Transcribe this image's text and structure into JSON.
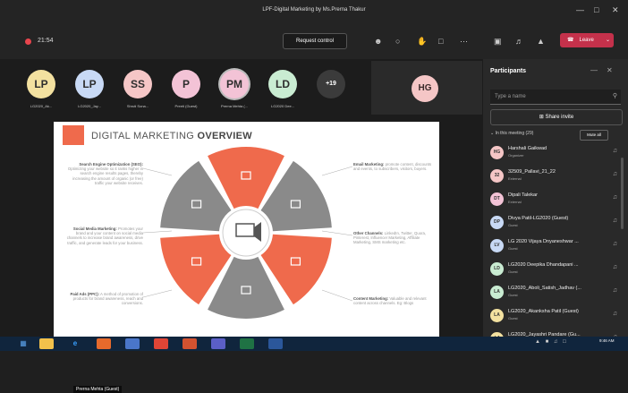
{
  "window": {
    "title": "LPF-Digital Marketing by Ms.Prerna Thakur",
    "minimize": "—",
    "maximize": "□",
    "close": "✕"
  },
  "toolbar": {
    "timer": "21:54",
    "request_control": "Request control",
    "icons": [
      "people-icon",
      "chat-icon",
      "reactions-icon",
      "rooms-icon",
      "more-icon",
      "camera-off-icon",
      "speaker-icon",
      "share-screen-icon"
    ],
    "leave_label": "Leave",
    "leave_color": "#c4314b"
  },
  "avatars": [
    {
      "initials": "LP",
      "name": "LG2020_Ak...",
      "color": "#f3e1a0"
    },
    {
      "initials": "LP",
      "name": "LG2020_Jay...",
      "color": "#c8d9f5"
    },
    {
      "initials": "SS",
      "name": "Shruti Sona...",
      "color": "#f5c6c6"
    },
    {
      "initials": "P",
      "name": "Preeti (Guest)",
      "color": "#f3c3d6"
    },
    {
      "initials": "PM",
      "name": "Prerna Mehta (...",
      "color": "#f3c3d6"
    },
    {
      "initials": "LD",
      "name": "LG2020 Dee...",
      "color": "#c9ecd2"
    }
  ],
  "more_count": "+19",
  "video_tile": {
    "initials": "HG"
  },
  "slide": {
    "title_light": "DIGITAL MARKETING ",
    "title_bold": "OVERVIEW",
    "accent": "#ef6a4c",
    "gray": "#8a8a8a",
    "blocks": [
      {
        "heading": "Search Engine Optimization (SEO):",
        "body": "Optimizing your website so it ranks higher in search engine results pages, thereby increasing the amount of organic (or free) traffic your website receives."
      },
      {
        "heading": "Social Media Marketing:",
        "body": "Promotes your brand and your content on social media channels to increase brand awareness, drive traffic, and generate leads for your business."
      },
      {
        "heading": "Paid Ads (PPC):",
        "body": "A method of promotion of products for brand awareness, reach and conversions."
      },
      {
        "heading": "Email Marketing:",
        "body": "promote content, discounts and events, to subscribers, visitors, buyers."
      },
      {
        "heading": "Other Channels:",
        "body": "LinkedIn, Twitter, Quora, Pinterest, Influencer Marketing, Affiliate Marketing, SMS marketing etc."
      },
      {
        "heading": "Content Marketing:",
        "body": "Valuable and relevant content across channels. Eg: Blogs"
      }
    ]
  },
  "speaker_label": "Prerna Mehta (Guest)",
  "participants": {
    "title": "Participants",
    "search_placeholder": "Type a name",
    "share_invite": "Share invite",
    "in_meeting": "In this meeting (29)",
    "mute_all": "Mute all",
    "list": [
      {
        "initials": "HG",
        "name": "Harshali Gaikwad",
        "role": "Organizer",
        "color": "#f5c6c6"
      },
      {
        "initials": "32",
        "name": "32509_Pallavi_21_22",
        "role": "External",
        "color": "#f5c6c6"
      },
      {
        "initials": "DT",
        "name": "Dipali Talekar",
        "role": "External",
        "color": "#f3c3d6"
      },
      {
        "initials": "DP",
        "name": "Divya Patil-LG2020 (Guest)",
        "role": "Guest",
        "color": "#c8d9f5"
      },
      {
        "initials": "LV",
        "name": "LG 2020 Vijaya Dnyaneshwar ...",
        "role": "Guest",
        "color": "#c8d9f5"
      },
      {
        "initials": "LD",
        "name": "LG2020 Deepika Dhandapani ...",
        "role": "Guest",
        "color": "#c9ecd2"
      },
      {
        "initials": "LA",
        "name": "LG2020_Aboli_Satish_Jadhav (...",
        "role": "Guest",
        "color": "#c9ecd2"
      },
      {
        "initials": "LA",
        "name": "LG2020_Akanksha Patil (Guest)",
        "role": "Guest",
        "color": "#f3e1a0"
      },
      {
        "initials": "LJ",
        "name": "LG2020_Jayashri Pandare (Gu...",
        "role": "Guest",
        "color": "#f3e1a0"
      }
    ]
  },
  "taskbar": {
    "icons": [
      "start-icon",
      "file-explorer-icon",
      "edge-icon",
      "firefox-icon",
      "media-icon",
      "chrome-icon",
      "powerpoint-icon",
      "teams-icon",
      "excel-icon",
      "word-icon"
    ],
    "time": "9:46 AM"
  }
}
